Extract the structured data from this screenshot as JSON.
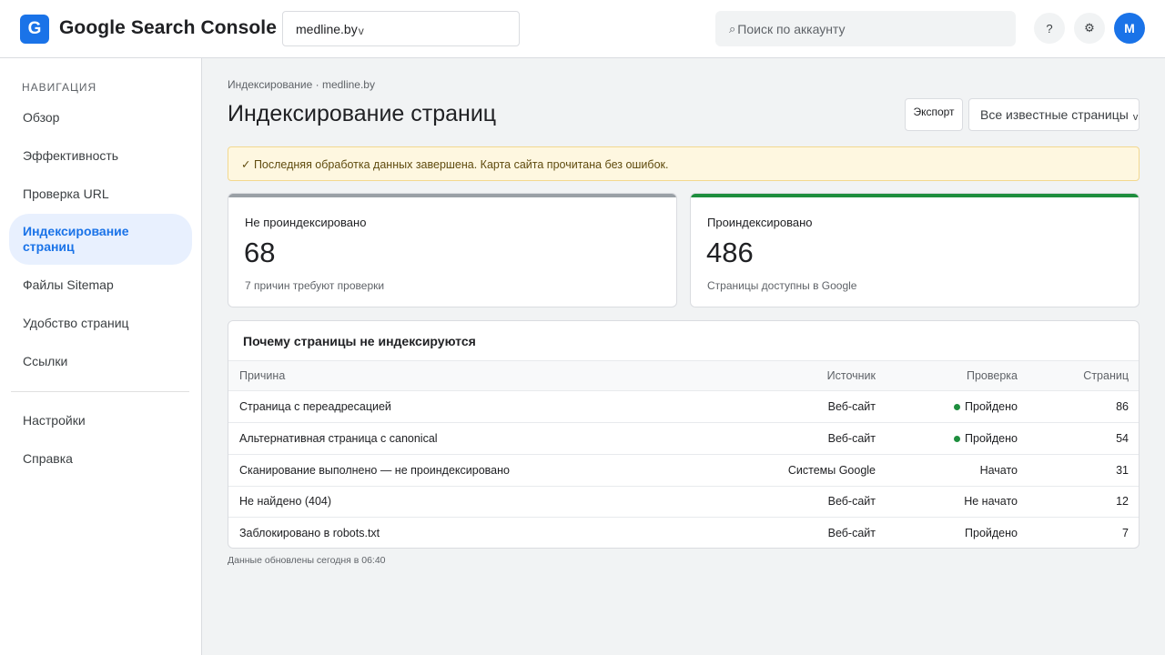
{
  "header": {
    "logo_letter": "G",
    "app_title": "Google Search Console",
    "property": "medline.by",
    "property_chevron": "v",
    "search_placeholder": "Поиск по аккаунту",
    "search_icon": "⌕",
    "help_label": "?",
    "settings_icon": "⚙",
    "avatar_letter": "M",
    "accent_color": "#1a73e8"
  },
  "sidebar": {
    "heading": "НАВИГАЦИЯ",
    "items": [
      {
        "label": "Обзор"
      },
      {
        "label": "Эффективность"
      },
      {
        "label": "Проверка URL"
      },
      {
        "label": "Индексирование страниц",
        "active": true
      },
      {
        "label": "Файлы Sitemap"
      },
      {
        "label": "Удобство страниц"
      },
      {
        "label": "Ссылки"
      }
    ],
    "secondary": [
      {
        "label": "Настройки"
      },
      {
        "label": "Справка"
      }
    ]
  },
  "main": {
    "breadcrumb": "Индексирование · medline.by",
    "title": "Индексирование страниц",
    "export_label": "Экспорт",
    "filter_value": "Все известные страницы",
    "filter_chevron": "v",
    "notice": "✓ Последняя обработка данных завершена. Карта сайта прочитана без ошибок.",
    "cards": [
      {
        "label": "Не проиндексировано",
        "value": "68",
        "sub": "7 причин требуют проверки",
        "color": "#9aa0a6"
      },
      {
        "label": "Проиндексировано",
        "value": "486",
        "sub": "Страницы доступны в Google",
        "color": "#1e8e3e"
      }
    ],
    "table": {
      "title": "Почему страницы не индексируются",
      "columns": {
        "reason": "Причина",
        "source": "Источник",
        "check": "Проверка",
        "count": "Страниц"
      },
      "rows": [
        {
          "reason": "Страница с переадресацией",
          "source": "Веб-сайт",
          "check": "Пройдено",
          "dot": true,
          "count": "86"
        },
        {
          "reason": "Альтернативная страница с canonical",
          "source": "Веб-сайт",
          "check": "Пройдено",
          "dot": true,
          "count": "54"
        },
        {
          "reason": "Сканирование выполнено — не проиндексировано",
          "source": "Системы Google",
          "check": "Начато",
          "dot": false,
          "count": "31"
        },
        {
          "reason": "Не найдено (404)",
          "source": "Веб-сайт",
          "check": "Не начато",
          "dot": false,
          "count": "12"
        },
        {
          "reason": "Заблокировано в robots.txt",
          "source": "Веб-сайт",
          "check": "Пройдено",
          "dot": false,
          "count": "7"
        }
      ]
    },
    "footnote": "Данные обновлены сегодня в 06:40"
  }
}
